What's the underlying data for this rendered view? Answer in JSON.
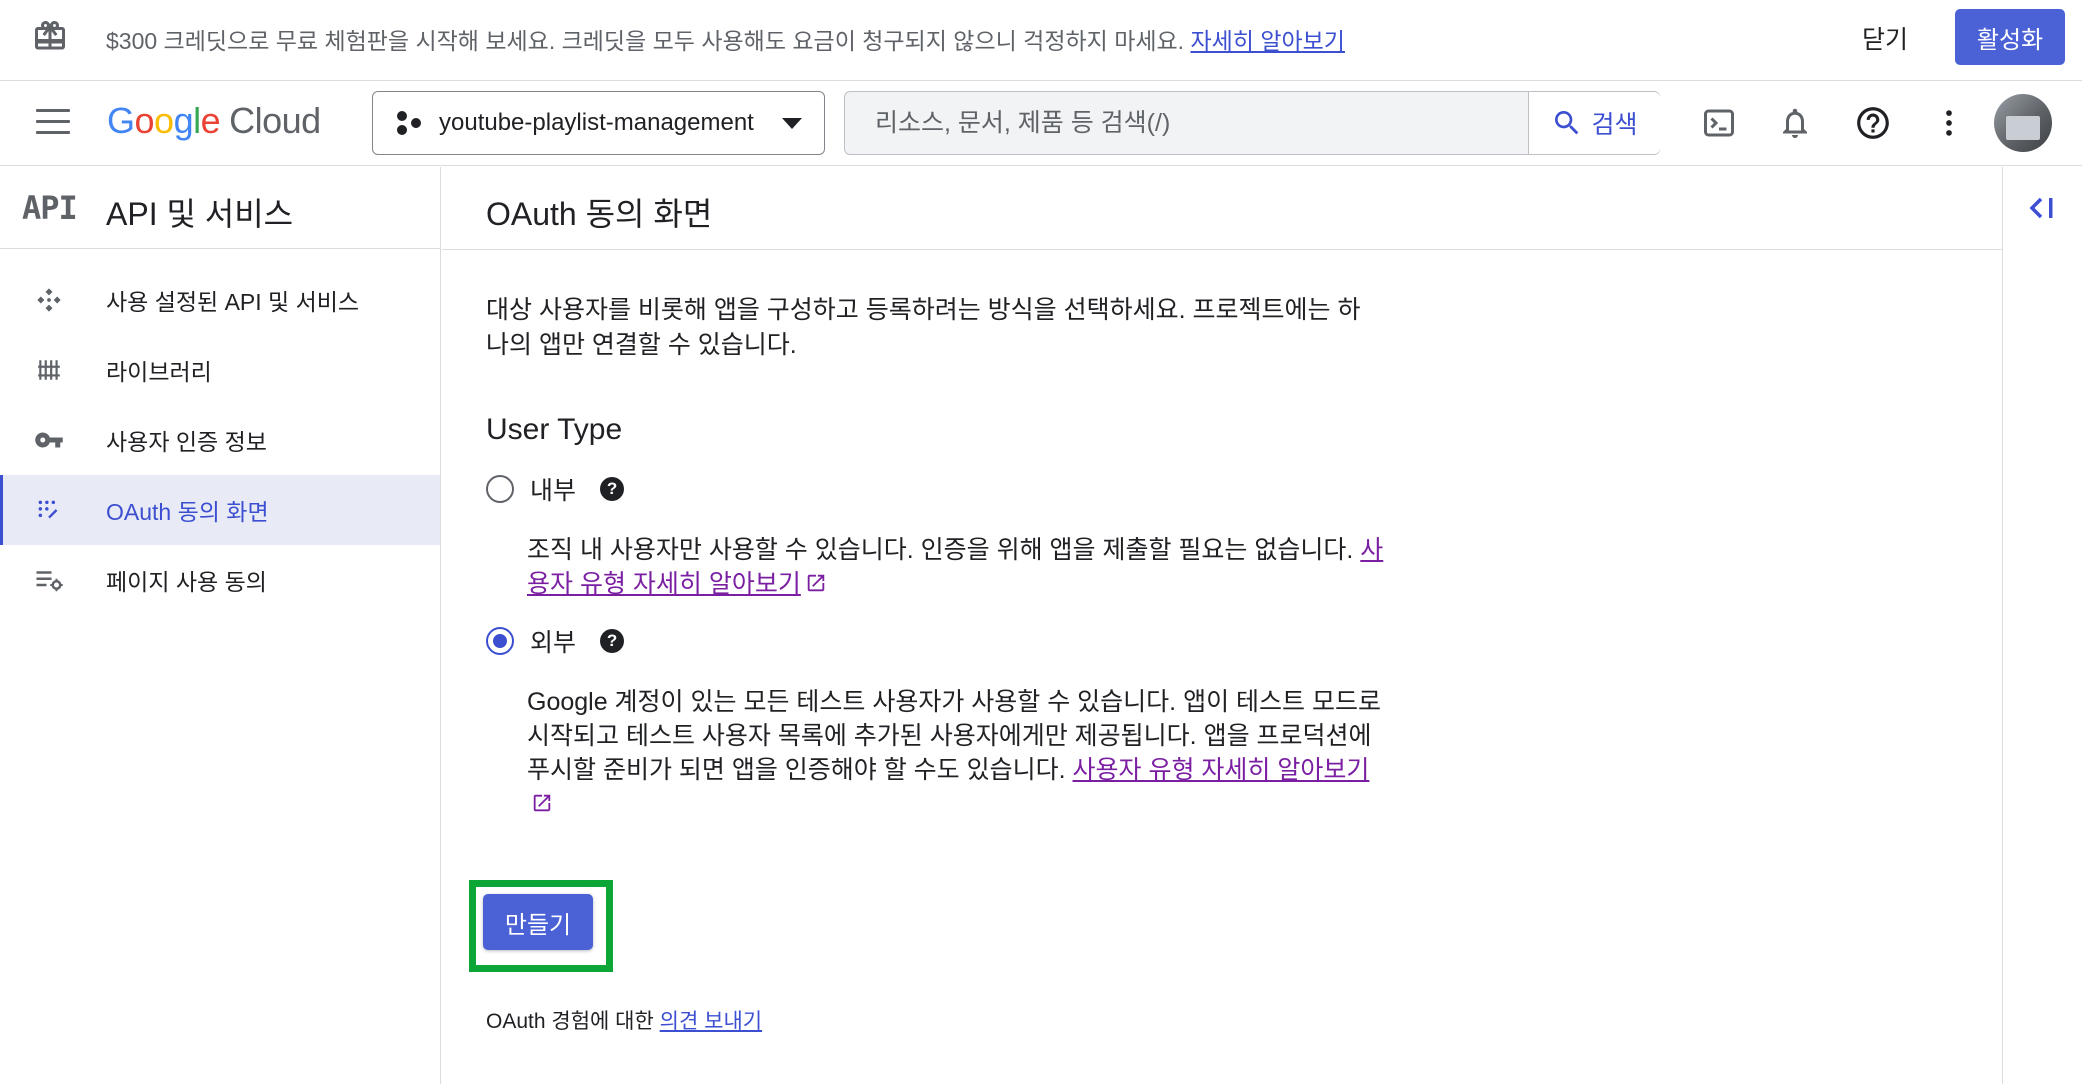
{
  "banner": {
    "text": "$300 크레딧으로 무료 체험판을 시작해 보세요. 크레딧을 모두 사용해도 요금이 청구되지 않으니 걱정하지 마세요.",
    "link": "자세히 알아보기",
    "close_label": "닫기",
    "activate_label": "활성화",
    "icon": "gift-icon"
  },
  "header": {
    "logo": {
      "google": "Google",
      "cloud": "Cloud"
    },
    "project": "youtube-playlist-management",
    "search_placeholder": "리소스, 문서, 제품 등 검색(/)",
    "search_button": "검색",
    "icons": [
      "menu-icon",
      "terminal-icon",
      "notifications-icon",
      "help-icon",
      "more-vert-icon",
      "avatar"
    ]
  },
  "sidebar": {
    "badge": "API",
    "title": "API 및 서비스",
    "items": [
      {
        "label": "사용 설정된 API 및 서비스",
        "icon": "api-icon",
        "active": false
      },
      {
        "label": "라이브러리",
        "icon": "library-icon",
        "active": false
      },
      {
        "label": "사용자 인증 정보",
        "icon": "key-icon",
        "active": false
      },
      {
        "label": "OAuth 동의 화면",
        "icon": "consent-icon",
        "active": true
      },
      {
        "label": "페이지 사용 동의",
        "icon": "page-settings-icon",
        "active": false
      }
    ]
  },
  "main": {
    "title": "OAuth 동의 화면",
    "intro": "대상 사용자를 비롯해 앱을 구성하고 등록하려는 방식을 선택하세요. 프로젝트에는 하나의 앱만 연결할 수 있습니다.",
    "user_type_heading": "User Type",
    "options": [
      {
        "label": "내부",
        "checked": false,
        "description": "조직 내 사용자만 사용할 수 있습니다. 인증을 위해 앱을 제출할 필요는 없습니다.",
        "link": "사용자 유형 자세히 알아보기"
      },
      {
        "label": "외부",
        "checked": true,
        "description": "Google 계정이 있는 모든 테스트 사용자가 사용할 수 있습니다. 앱이 테스트 모드로 시작되고 테스트 사용자 목록에 추가된 사용자에게만 제공됩니다. 앱을 프로덕션에 푸시할 준비가 되면 앱을 인증해야 할 수도 있습니다.",
        "link": "사용자 유형 자세히 알아보기"
      }
    ],
    "create_button": "만들기",
    "feedback_text": "OAuth 경험에 대한",
    "feedback_link": "의견 보내기"
  },
  "colors": {
    "primary": "#4b62d6",
    "link": "#3c4fd1",
    "visited_link": "#7b1fa2",
    "highlight": "#0ba636",
    "active_nav_bg": "#e8eaf6"
  }
}
